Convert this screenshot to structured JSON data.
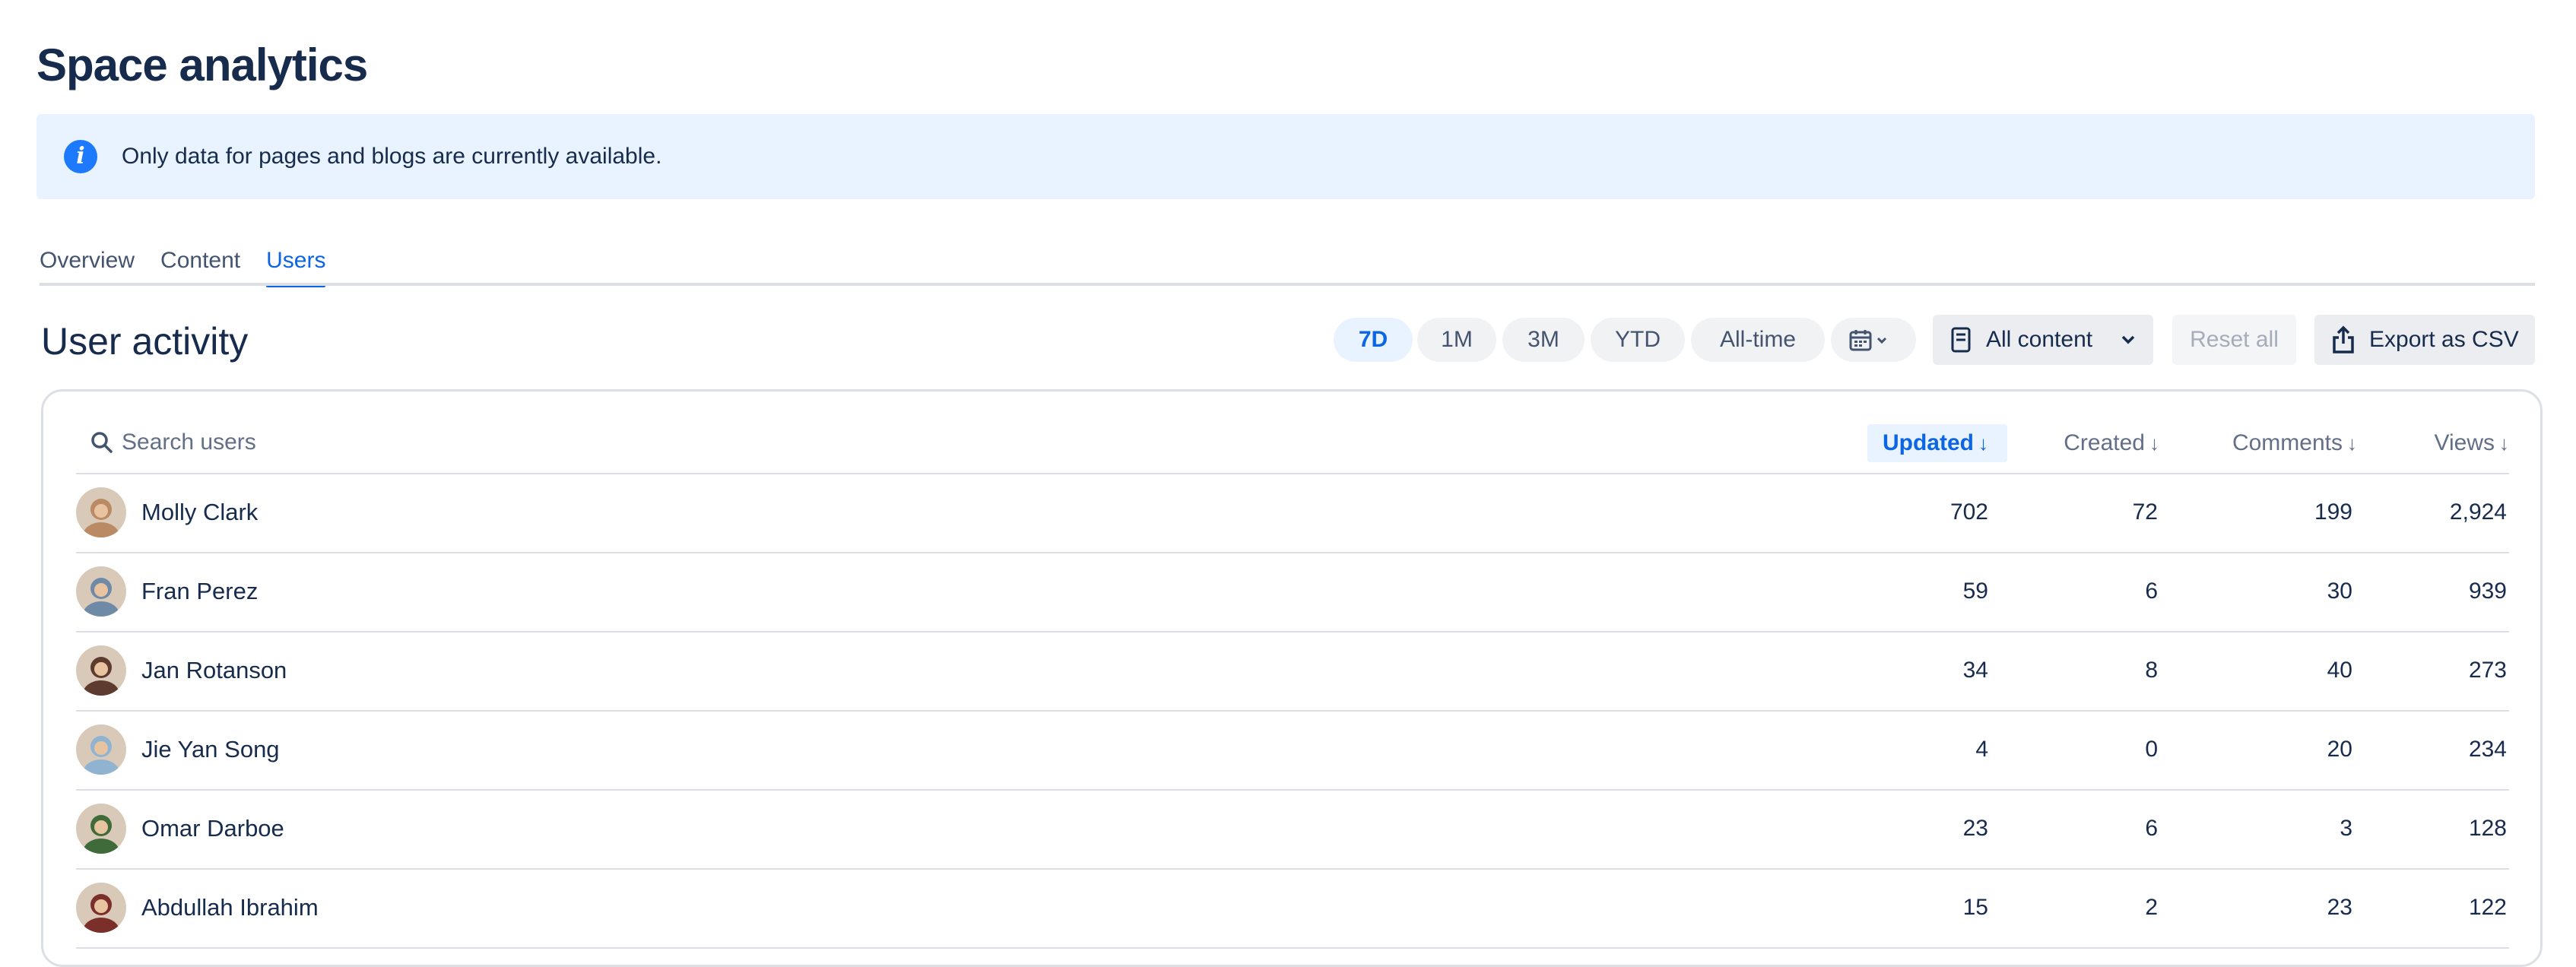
{
  "page_title": "Space analytics",
  "banner": {
    "message": "Only data for pages and blogs are currently available."
  },
  "tabs": [
    {
      "label": "Overview",
      "active": false
    },
    {
      "label": "Content",
      "active": false
    },
    {
      "label": "Users",
      "active": true
    }
  ],
  "section_title": "User activity",
  "ranges": [
    {
      "label": "7D",
      "active": true
    },
    {
      "label": "1M",
      "active": false
    },
    {
      "label": "3M",
      "active": false
    },
    {
      "label": "YTD",
      "active": false
    },
    {
      "label": "All-time",
      "active": false
    }
  ],
  "filter": {
    "label": "All content"
  },
  "reset_label": "Reset all",
  "export_label": "Export as CSV",
  "search": {
    "placeholder": "Search users",
    "value": ""
  },
  "columns": {
    "updated": "Updated",
    "created": "Created",
    "comments": "Comments",
    "views": "Views",
    "sorted_by": "Updated"
  },
  "users": [
    {
      "name": "Molly Clark",
      "updated": "702",
      "created": "72",
      "comments": "199",
      "views": "2,924",
      "avatar_color": "#b98a63"
    },
    {
      "name": "Fran Perez",
      "updated": "59",
      "created": "6",
      "comments": "30",
      "views": "939",
      "avatar_color": "#6f8aa6"
    },
    {
      "name": "Jan Rotanson",
      "updated": "34",
      "created": "8",
      "comments": "40",
      "views": "273",
      "avatar_color": "#5d3b2e"
    },
    {
      "name": "Jie Yan Song",
      "updated": "4",
      "created": "0",
      "comments": "20",
      "views": "234",
      "avatar_color": "#8fb3d1"
    },
    {
      "name": "Omar Darboe",
      "updated": "23",
      "created": "6",
      "comments": "3",
      "views": "128",
      "avatar_color": "#3f6b3a"
    },
    {
      "name": "Abdullah Ibrahim",
      "updated": "15",
      "created": "2",
      "comments": "23",
      "views": "122",
      "avatar_color": "#7a2f2a"
    }
  ],
  "colors": {
    "accent": "#0C66E4",
    "banner_bg": "#E9F2FF",
    "info_icon": "#1D7AFC"
  }
}
